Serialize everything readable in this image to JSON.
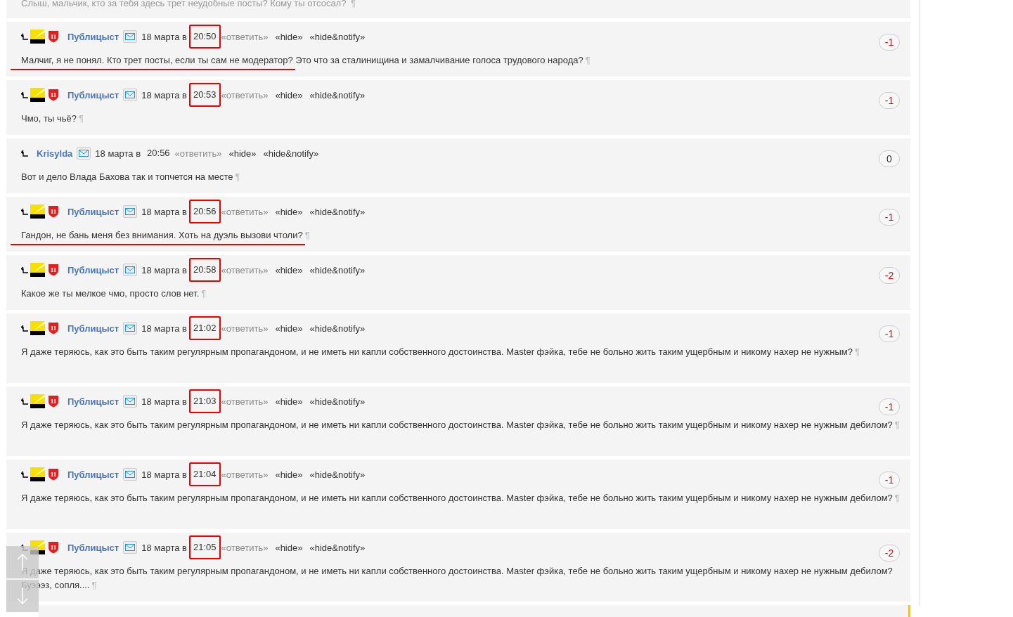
{
  "top_comment": {
    "text": "Слыш, мальчик, кто за тебя здесь трет неудобные посты? Кому ты отсосал?",
    "mark": "¶"
  },
  "comments": [
    {
      "author": "Публицыст",
      "badges": true,
      "rank": "11",
      "date": "18 марта в",
      "time": "20:50",
      "reply": "«ответить»",
      "hide": "«hide»",
      "hide_notify": "«hide&notify»",
      "score": "-1",
      "negative": true,
      "time_boxed": true,
      "underlined": true,
      "text": [
        "Малчиг, я не понял. Кто трет посты, если ты сам не модератор?",
        " Это что за сталинищина и замалчивание голоса трудового народа?"
      ],
      "mark": "¶",
      "tall": false
    },
    {
      "author": "Публицыст",
      "badges": true,
      "rank": "11",
      "date": "18 марта в",
      "time": "20:53",
      "reply": "«ответить»",
      "hide": "«hide»",
      "hide_notify": "«hide&notify»",
      "score": "-1",
      "negative": true,
      "time_boxed": true,
      "underlined": false,
      "text": [
        "Чмо, ты чьё?"
      ],
      "mark": "¶",
      "tall": false
    },
    {
      "author": "Krisylda",
      "badges": false,
      "date": "18 марта в",
      "time": "20:56",
      "reply": "«ответить»",
      "hide": "«hide»",
      "hide_notify": "«hide&notify»",
      "score": "0",
      "negative": false,
      "time_boxed": false,
      "underlined": false,
      "text": [
        "Вот и дело Влада Бахова так и топчется на месте"
      ],
      "mark": "¶",
      "tall": false
    },
    {
      "author": "Публицыст",
      "badges": true,
      "rank": "11",
      "date": "18 марта в",
      "time": "20:56",
      "reply": "«ответить»",
      "hide": "«hide»",
      "hide_notify": "«hide&notify»",
      "score": "-1",
      "negative": true,
      "time_boxed": true,
      "underlined": true,
      "text": [
        "Гандон, не бань меня без внимания. Хоть на дуэль вызови чтоли?"
      ],
      "mark": "¶",
      "tall": false
    },
    {
      "author": "Публицыст",
      "badges": true,
      "rank": "11",
      "date": "18 марта в",
      "time": "20:58",
      "reply": "«ответить»",
      "hide": "«hide»",
      "hide_notify": "«hide&notify»",
      "score": "-2",
      "negative": true,
      "time_boxed": true,
      "underlined": false,
      "text": [
        "Какое же ты мелкое чмо, просто слов нет."
      ],
      "mark": "¶",
      "tall": false
    },
    {
      "author": "Публицыст",
      "badges": true,
      "rank": "11",
      "date": "18 марта в",
      "time": "21:02",
      "reply": "«ответить»",
      "hide": "«hide»",
      "hide_notify": "«hide&notify»",
      "score": "-1",
      "negative": true,
      "time_boxed": true,
      "underlined": false,
      "text": [
        "Я даже теряюсь, как это быть таким регулярным пропагандоном, и не иметь ни капли собственного достоинства. Master фэйка, тебе не больно жить таким ущербным и никому нахер не нужным?"
      ],
      "mark": "¶",
      "tall": true
    },
    {
      "author": "Публицыст",
      "badges": true,
      "rank": "11",
      "date": "18 марта в",
      "time": "21:03",
      "reply": "«ответить»",
      "hide": "«hide»",
      "hide_notify": "«hide&notify»",
      "score": "-1",
      "negative": true,
      "time_boxed": true,
      "underlined": false,
      "text": [
        "Я даже теряюсь, как это быть таким регулярным пропагандоном, и не иметь ни капли собственного достоинства. Master фэйка, тебе не больно жить таким ущербным и никому нахер не нужным дебилом?"
      ],
      "mark": "¶",
      "tall": true
    },
    {
      "author": "Публицыст",
      "badges": true,
      "rank": "11",
      "date": "18 марта в",
      "time": "21:04",
      "reply": "«ответить»",
      "hide": "«hide»",
      "hide_notify": "«hide&notify»",
      "score": "-1",
      "negative": true,
      "time_boxed": true,
      "underlined": false,
      "text": [
        "Я даже теряюсь, как это быть таким регулярным пропагандоном, и не иметь ни капли собственного достоинства. Master фэйка, тебе не больно жить таким ущербным и никому нахер не нужным дебилом?"
      ],
      "mark": "¶",
      "tall": true
    },
    {
      "author": "Публицыст",
      "badges": true,
      "rank": "11",
      "date": "18 марта в",
      "time": "21:05",
      "reply": "«ответить»",
      "hide": "«hide»",
      "hide_notify": "«hide&notify»",
      "score": "-2",
      "negative": true,
      "time_boxed": true,
      "underlined": false,
      "text": [
        "Я даже теряюсь, как это быть таким регулярным пропагандоном, и не иметь ни капли собственного достоинства. Master фэйка, тебе не больно жить таким ущербным и никому нахер не нужным дебилом?",
        "Буэээз, сопля...."
      ],
      "mark": "¶",
      "tall": false
    }
  ]
}
